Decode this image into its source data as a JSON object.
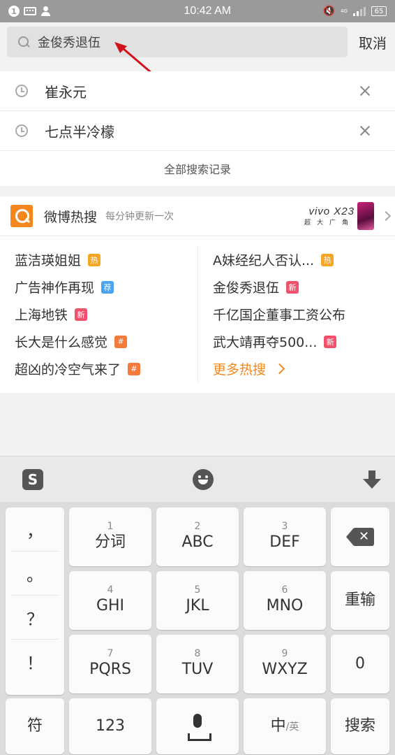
{
  "status_bar": {
    "notification_count": "1",
    "time": "10:42 AM",
    "network": "4G",
    "battery": "65"
  },
  "search": {
    "value": "金俊秀退伍",
    "cancel_label": "取消"
  },
  "history": {
    "items": [
      {
        "text": "崔永元"
      },
      {
        "text": "七点半冷檬"
      }
    ],
    "all_label": "全部搜索记录"
  },
  "hot_search": {
    "title": "微博热搜",
    "subtitle": "每分钟更新一次",
    "ad": {
      "brand": "vivo X23",
      "slogan": "超大广角"
    },
    "left": [
      {
        "text": "蓝洁瑛姐姐",
        "badge": "热",
        "badge_color": "#f5a623"
      },
      {
        "text": "广告神作再现",
        "badge": "荐",
        "badge_color": "#4aa3ef"
      },
      {
        "text": "上海地铁",
        "badge": "新",
        "badge_color": "#f2516e"
      },
      {
        "text": "长大是什么感觉",
        "badge": "#",
        "badge_color": "#f47a3c"
      },
      {
        "text": "超凶的冷空气来了",
        "badge": "#",
        "badge_color": "#f47a3c"
      }
    ],
    "right": [
      {
        "text": "A妹经纪人否认...",
        "badge": "热",
        "badge_color": "#f5a623"
      },
      {
        "text": "金俊秀退伍",
        "badge": "新",
        "badge_color": "#f2516e"
      },
      {
        "text": "千亿国企董事工资公布",
        "badge": "",
        "badge_color": ""
      },
      {
        "text": "武大靖再夺500...",
        "badge": "新",
        "badge_color": "#f2516e"
      }
    ],
    "more_label": "更多热搜"
  },
  "keyboard": {
    "punctuation": [
      "，",
      "。",
      "？",
      "！"
    ],
    "keys": {
      "k1": {
        "num": "1",
        "label": "分词"
      },
      "k2": {
        "num": "2",
        "label": "ABC"
      },
      "k3": {
        "num": "3",
        "label": "DEF"
      },
      "k4": {
        "num": "4",
        "label": "GHI"
      },
      "k5": {
        "num": "5",
        "label": "JKL"
      },
      "k6": {
        "num": "6",
        "label": "MNO"
      },
      "k7": {
        "num": "7",
        "label": "PQRS"
      },
      "k8": {
        "num": "8",
        "label": "TUV"
      },
      "k9": {
        "num": "9",
        "label": "WXYZ"
      }
    },
    "reenter": "重输",
    "zero": "0",
    "symbol": "符",
    "num_switch": "123",
    "lang_main": "中",
    "lang_sub": "/英",
    "search": "搜索",
    "sogou_icon": "S"
  },
  "colors": {
    "accent": "#f5871f",
    "status_bar": "#9a9a9a"
  }
}
